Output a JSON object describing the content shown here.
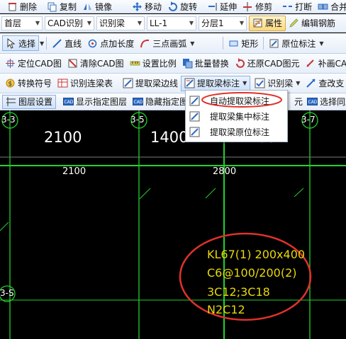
{
  "toolbar": {
    "row1": {
      "delete": "删除",
      "copy": "复制",
      "mirror": "镜像",
      "move": "移动",
      "rotate": "旋转",
      "extend": "延伸",
      "trim": "修剪",
      "break": "打断",
      "merge": "合并"
    },
    "row2": {
      "floor": "首层",
      "cad_recognize": "CAD识别",
      "recognize_beam": "识别梁",
      "beam_name": "LL-1",
      "layer": "分层1",
      "properties": "属性",
      "edit_rebar": "编辑钢筋"
    },
    "row3": {
      "select": "选择",
      "line": "直线",
      "point_length": "点加长度",
      "three_point_arc": "三点画弧",
      "rectangle": "矩形",
      "original_position_label": "原位标注"
    },
    "row4": {
      "locate_cad": "定位CAD图",
      "clear_cad": "清除CAD图",
      "set_scale": "设置比例",
      "batch_replace": "批量替换",
      "restore_cad": "还原CAD图元",
      "redraw_cad": "补画CAD图"
    },
    "row5": {
      "convert_symbol": "转换符号",
      "recognize_beam_table": "识别连梁表",
      "extract_beam_edge": "提取梁边线",
      "extract_beam_label": "提取梁标注",
      "recognize_beam": "识别梁",
      "check_support": "查改支"
    },
    "row6": {
      "layer_settings": "图层设置",
      "show_layer": "显示指定图层",
      "hide_layer": "隐藏指定图",
      "element_suffix": "元",
      "select_same": "选择同颜"
    }
  },
  "menu": {
    "items": [
      {
        "label": "自动提取梁标注"
      },
      {
        "label": "提取梁集中标注"
      },
      {
        "label": "提取梁原位标注"
      }
    ]
  },
  "canvas": {
    "axis_labels": {
      "a1": "3-3",
      "a2": "3-5",
      "a3": "3-7",
      "b1": "3-S"
    },
    "dims": {
      "d1": "2100",
      "d2": "1400",
      "d3": "1400",
      "d4": "2100",
      "d5": "2800"
    },
    "beam_annotation": {
      "line1": "KL67(1) 200x400",
      "line2": "C6@100/200(2)",
      "line3": "3C12;3C18",
      "line4": "N2C12"
    }
  },
  "colors": {
    "grid_green": "#22d22b",
    "highlight_red": "#e0322a",
    "annotation_yellow": "#e8d70a"
  }
}
